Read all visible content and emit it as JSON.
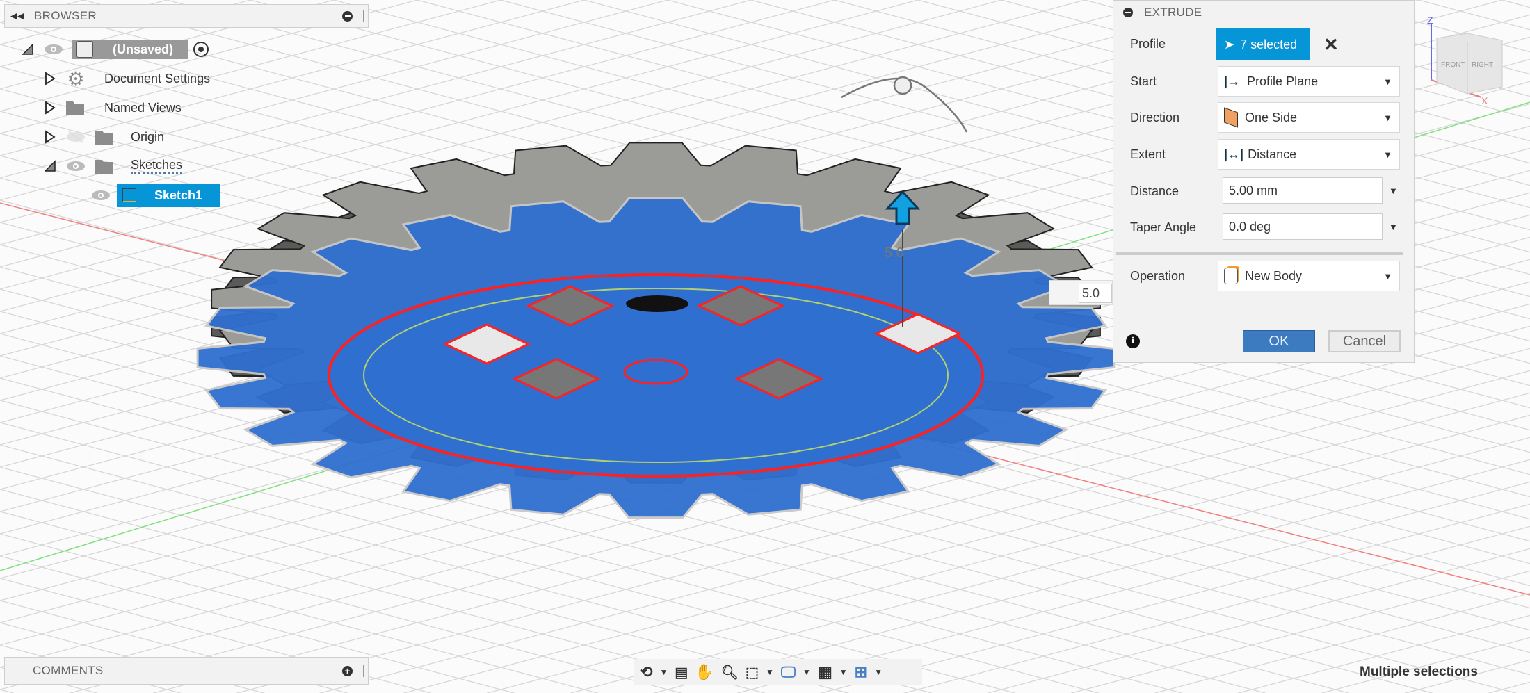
{
  "browser": {
    "title": "BROWSER",
    "root": {
      "label": "(Unsaved)"
    },
    "items": [
      {
        "label": "Document Settings",
        "icon": "gear-icon"
      },
      {
        "label": "Named Views",
        "icon": "folder-icon"
      },
      {
        "label": "Origin",
        "icon": "folder-icon"
      },
      {
        "label": "Sketches",
        "icon": "folder-icon"
      },
      {
        "label": "Sketch1",
        "icon": "sketch-icon",
        "selected": true
      }
    ]
  },
  "comments": {
    "title": "COMMENTS"
  },
  "extrude": {
    "title": "EXTRUDE",
    "profile": {
      "label": "Profile",
      "value": "7 selected"
    },
    "start": {
      "label": "Start",
      "value": "Profile Plane"
    },
    "direction": {
      "label": "Direction",
      "value": "One Side"
    },
    "extent": {
      "label": "Extent",
      "value": "Distance"
    },
    "distance": {
      "label": "Distance",
      "value": "5.00 mm"
    },
    "taper": {
      "label": "Taper Angle",
      "value": "0.0 deg"
    },
    "operation": {
      "label": "Operation",
      "value": "New Body"
    },
    "ok": "OK",
    "cancel": "Cancel"
  },
  "viewport": {
    "dimension_input": "5.0",
    "dimension_label": "5.0",
    "viewcube": {
      "front": "FRONT",
      "right": "RIGHT",
      "z": "Z",
      "x": "X"
    }
  },
  "status": {
    "text": "Multiple selections"
  },
  "colors": {
    "accent": "#0696d7",
    "profile_blue": "#2f6fd0",
    "body_grey": "#9b9b98",
    "selection_red": "#ff2020",
    "ok_button": "#3c7bbf"
  }
}
